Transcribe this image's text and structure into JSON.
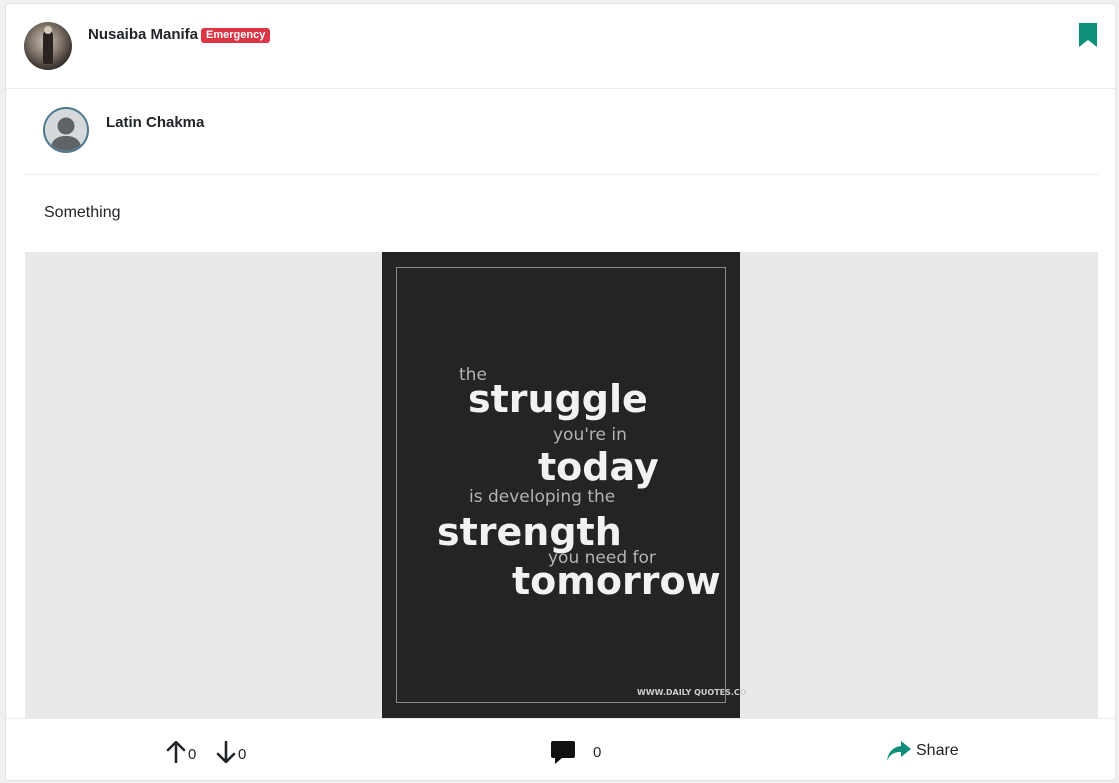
{
  "post": {
    "author": {
      "name": "Nusaiba Manifa",
      "badge": "Emergency"
    },
    "shared_from": {
      "name": "Latin Chakma"
    },
    "text": "Something",
    "image": {
      "lines": [
        "the",
        "struggle",
        "you're in",
        "today",
        "is developing the",
        "strength",
        "you need for",
        "tomorrow"
      ],
      "site": "WWW.DAILY QUOTES.CO"
    }
  },
  "actions": {
    "upvotes": "0",
    "downvotes": "0",
    "comments": "0",
    "share_label": "Share"
  },
  "colors": {
    "accent": "#0e8f7a",
    "badge": "#dc3545",
    "poster_bg": "#252323",
    "media_bg": "#e9e9e9"
  },
  "icons": [
    "bookmark-icon",
    "arrow-up-icon",
    "arrow-down-icon",
    "comment-icon",
    "share-icon",
    "default-avatar-icon"
  ]
}
